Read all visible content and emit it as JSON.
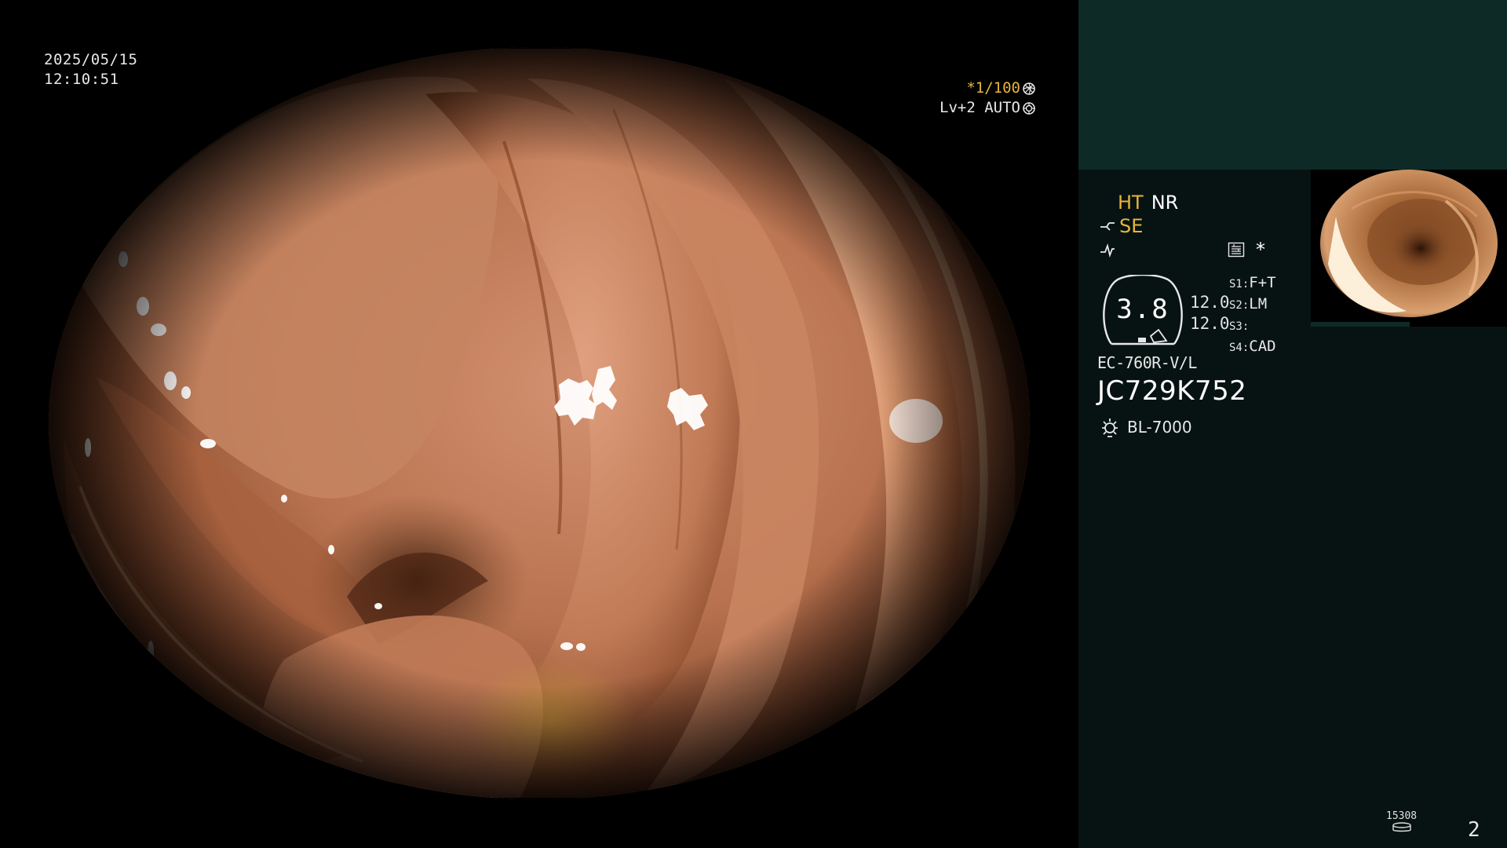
{
  "osd": {
    "date": "2025/05/15",
    "time": "12:10:51",
    "shutter": "*1/100",
    "level": "Lv+2 AUTO"
  },
  "panel": {
    "mode_ht": "HT",
    "mode_nr": "NR",
    "mode_se": "SE",
    "asterisk": "*",
    "zoom": "3.8",
    "level_top": "12.0",
    "level_bottom": "12.0",
    "switches": [
      {
        "label": "S1",
        "value": "F+T"
      },
      {
        "label": "S2",
        "value": "LM"
      },
      {
        "label": "S3",
        "value": ""
      },
      {
        "label": "S4",
        "value": "CAD"
      }
    ],
    "scope_model": "EC-760R-V/L",
    "scope_serial": "JC729K752",
    "light_source": "BL-7000",
    "counter": "15308",
    "page_number": "2"
  },
  "colors": {
    "accent_yellow": "#e7b53b",
    "panel_top": "#0d2a27",
    "panel_body": "#071312",
    "tissue_base": "#b5714b"
  },
  "icons": {
    "shutter_icon": "aperture-icon",
    "auto_icon": "iris-icon",
    "se_icon": "scope-tip-icon",
    "pump_icon": "waveform-icon",
    "grid_icon": "structure-enhance-icon",
    "light_icon": "light-source-icon",
    "counter_icon": "disk-counter-icon"
  }
}
